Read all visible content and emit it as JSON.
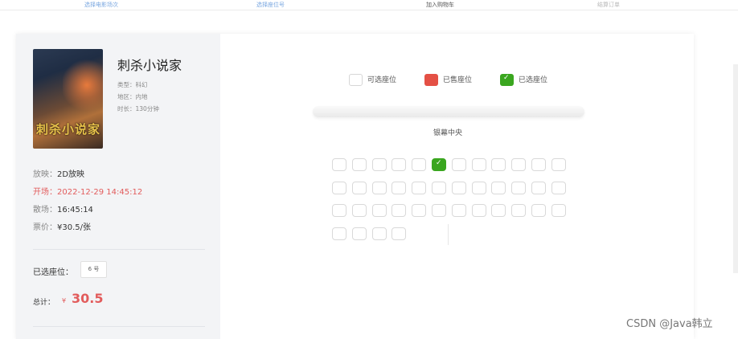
{
  "steps": [
    {
      "label": "选择电影场次",
      "state": "done"
    },
    {
      "label": "选择座位号",
      "state": "done"
    },
    {
      "label": "加入购物车",
      "state": "current"
    },
    {
      "label": "结算订单",
      "state": "todo"
    }
  ],
  "movie": {
    "title": "刺杀小说家",
    "poster_text": "刺杀小说家",
    "type_label": "类型：",
    "type_value": "科幻",
    "region_label": "地区：",
    "region_value": "内地",
    "duration_label": "时长：",
    "duration_value": "130分钟"
  },
  "showing": {
    "version_label": "放映：",
    "version_value": "2D放映",
    "start_label": "开场：",
    "start_value": "2022-12-29 14:45:12",
    "end_label": "散场：",
    "end_value": "16:45:14",
    "price_label": "票价：",
    "price_value": "¥30.5/张"
  },
  "selection": {
    "label": "已选座位：",
    "seat": "6 号"
  },
  "total": {
    "label": "总计：",
    "symbol": "¥",
    "value": "30.5"
  },
  "legend": {
    "available": "可选座位",
    "sold": "已售座位",
    "selected": "已选座位"
  },
  "screen_label": "银幕中央",
  "seat_rows": [
    {
      "count": 12,
      "selected": [
        6
      ]
    },
    {
      "count": 12,
      "selected": []
    },
    {
      "count": 12,
      "selected": []
    },
    {
      "count": 4,
      "selected": []
    }
  ],
  "colors": {
    "sold": "#e45045",
    "selected": "#3aa61f",
    "price": "#e25c5c",
    "step_done": "#7aa7e0"
  },
  "watermark": "CSDN @Java韩立"
}
